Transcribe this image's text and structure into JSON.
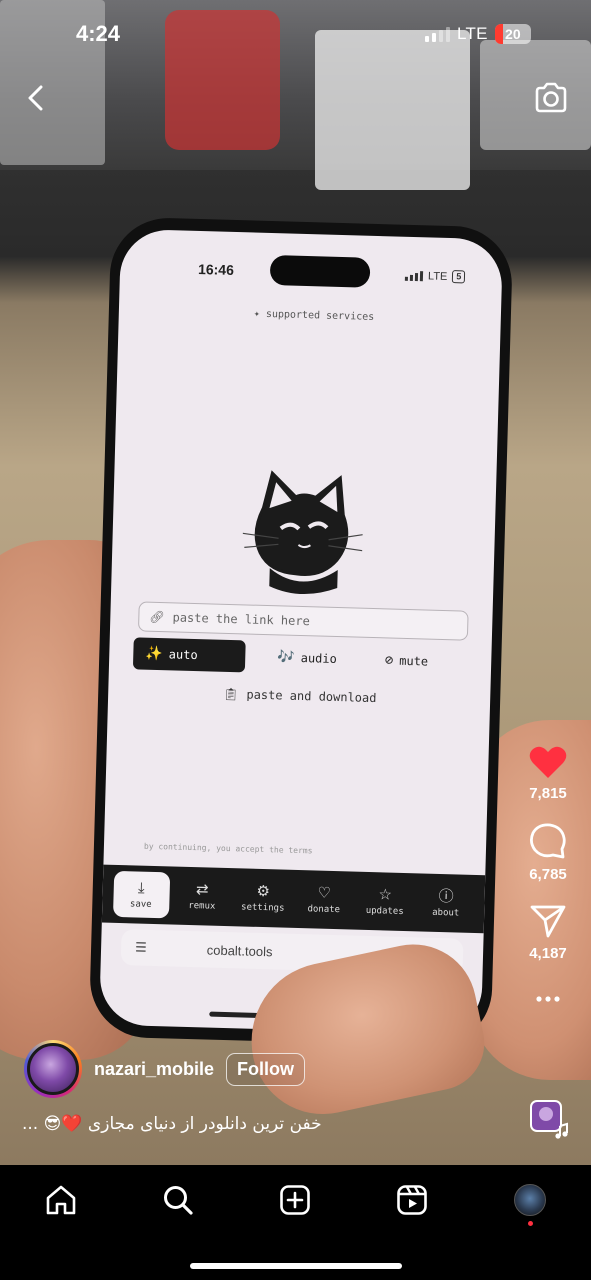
{
  "status_bar": {
    "time": "4:24",
    "network": "LTE",
    "battery": "20"
  },
  "video": {
    "phone_screen": {
      "time": "16:46",
      "network": "LTE",
      "battery": "5",
      "supported_services": "supported services",
      "link_placeholder": "paste the link here",
      "modes": [
        {
          "label": "auto",
          "icon": "sparkles-icon"
        },
        {
          "label": "audio",
          "icon": "music-icon"
        },
        {
          "label": "mute",
          "icon": "mute-icon"
        }
      ],
      "paste_download": "paste and download",
      "terms": "by continuing, you accept the terms",
      "tabs": [
        {
          "label": "save",
          "icon": "download-icon"
        },
        {
          "label": "remux",
          "icon": "repeat-icon"
        },
        {
          "label": "settings",
          "icon": "gear-icon"
        },
        {
          "label": "donate",
          "icon": "heart-icon"
        },
        {
          "label": "updates",
          "icon": "star-icon"
        },
        {
          "label": "about",
          "icon": "info-icon"
        }
      ],
      "url": "cobalt.tools"
    }
  },
  "actions": {
    "likes": "7,815",
    "comments": "6,785",
    "shares": "4,187"
  },
  "author": {
    "username": "nazari_mobile",
    "follow_label": "Follow"
  },
  "caption": "... 😎❤️ خفن ترین دانلودر از دنیای مجازی",
  "colors": {
    "like": "#ff3040",
    "nav_background": "#000000",
    "notification_dot": "#ff3040"
  }
}
